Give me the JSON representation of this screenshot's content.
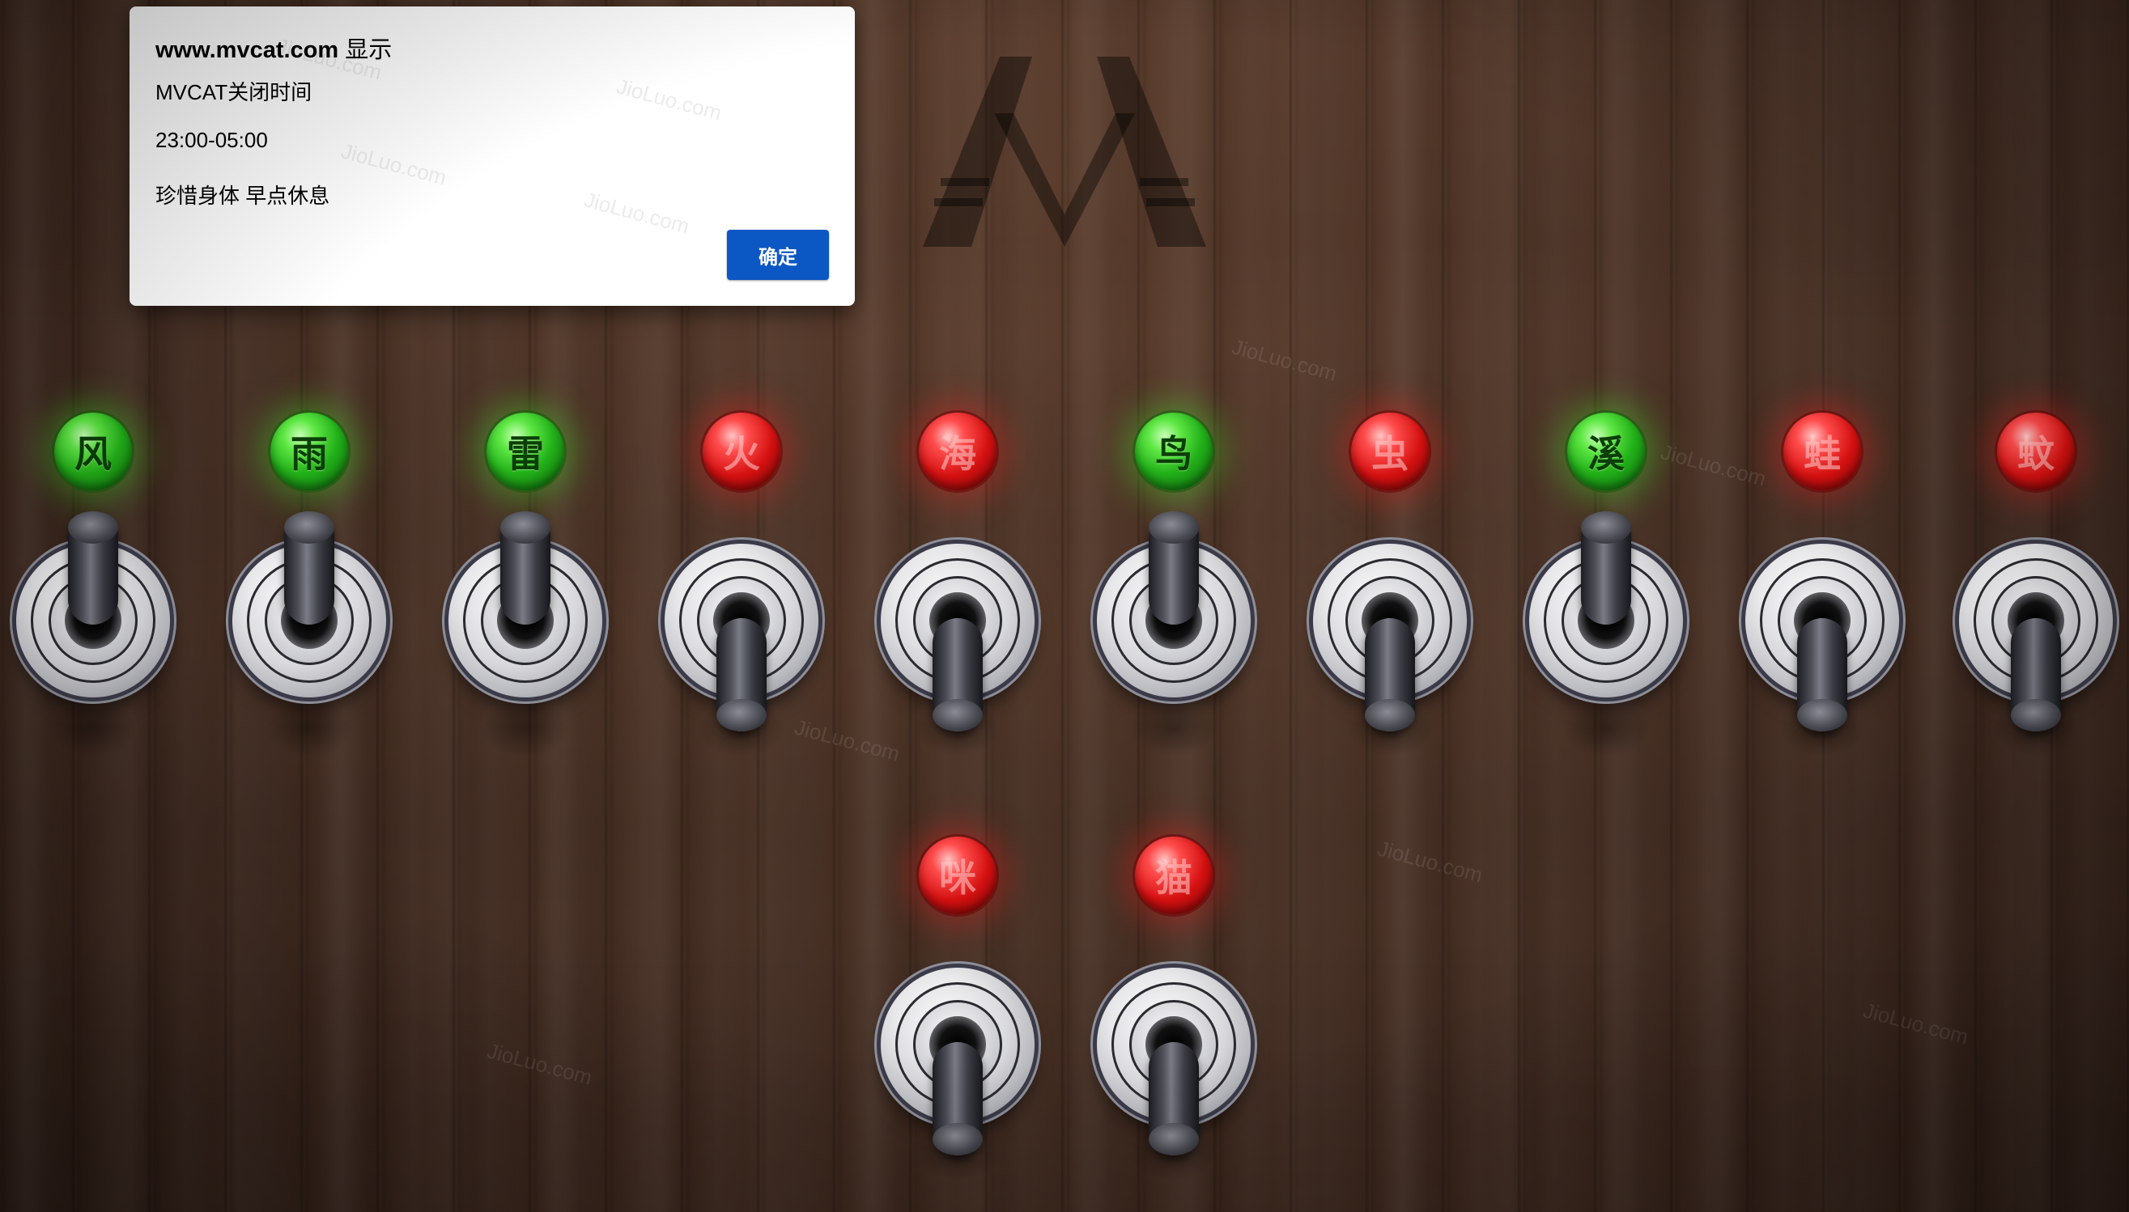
{
  "dialog": {
    "site": "www.mvcat.com",
    "suffix": "显示",
    "lines": [
      "MVCAT关闭时间",
      "23:00-05:00",
      "珍惜身体 早点休息"
    ],
    "ok_label": "确定",
    "button_color": "#0b57c4"
  },
  "watermark_text": "JioLuo.com",
  "logo_icon": "mvcat-m-logo-icon",
  "switches": [
    {
      "label": "风",
      "state": "on"
    },
    {
      "label": "雨",
      "state": "on"
    },
    {
      "label": "雷",
      "state": "on"
    },
    {
      "label": "火",
      "state": "off"
    },
    {
      "label": "海",
      "state": "off"
    },
    {
      "label": "鸟",
      "state": "on"
    },
    {
      "label": "虫",
      "state": "off"
    },
    {
      "label": "溪",
      "state": "on"
    },
    {
      "label": "蛙",
      "state": "off"
    },
    {
      "label": "蚊",
      "state": "off"
    },
    {
      "label": "咪",
      "state": "off"
    },
    {
      "label": "猫",
      "state": "off"
    }
  ],
  "colors": {
    "lamp_on": "#22b019",
    "lamp_off": "#d51111",
    "wood": "#4a3124"
  }
}
